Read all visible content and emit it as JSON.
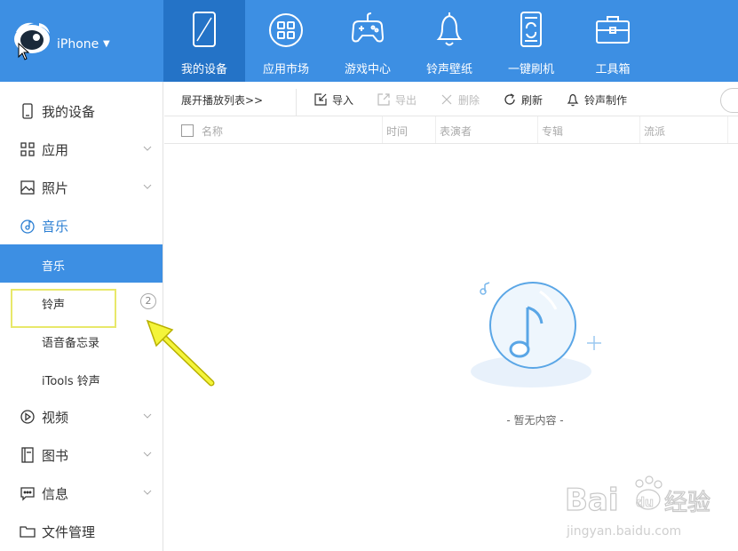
{
  "device": {
    "name": "iPhone"
  },
  "nav": [
    {
      "label": "我的设备",
      "icon": "tablet-icon",
      "active": true
    },
    {
      "label": "应用市场",
      "icon": "apps-grid-icon",
      "active": false
    },
    {
      "label": "游戏中心",
      "icon": "gamepad-icon",
      "active": false
    },
    {
      "label": "铃声壁纸",
      "icon": "bell-icon",
      "active": false
    },
    {
      "label": "一键刷机",
      "icon": "flash-phone-icon",
      "active": false
    },
    {
      "label": "工具箱",
      "icon": "toolbox-icon",
      "active": false
    }
  ],
  "sidebar": {
    "items": [
      {
        "label": "我的设备",
        "icon": "phone-icon"
      },
      {
        "label": "应用",
        "icon": "grid-icon"
      },
      {
        "label": "照片",
        "icon": "image-icon"
      },
      {
        "label": "音乐",
        "icon": "music-disc-icon"
      },
      {
        "label": "音乐",
        "icon": ""
      },
      {
        "label": "铃声",
        "icon": "",
        "badge": "2"
      },
      {
        "label": "语音备忘录",
        "icon": ""
      },
      {
        "label": "iTools 铃声",
        "icon": ""
      },
      {
        "label": "视频",
        "icon": "play-icon"
      },
      {
        "label": "图书",
        "icon": "book-icon"
      },
      {
        "label": "信息",
        "icon": "message-icon"
      },
      {
        "label": "文件管理",
        "icon": "folder-icon"
      }
    ]
  },
  "toolbar": {
    "expand_label": "展开播放列表>>",
    "import_label": "导入",
    "export_label": "导出",
    "delete_label": "删除",
    "refresh_label": "刷新",
    "ringtone_label": "铃声制作"
  },
  "table": {
    "columns": [
      "名称",
      "时间",
      "表演者",
      "专辑",
      "流派"
    ]
  },
  "empty": {
    "text": "- 暂无内容 -"
  },
  "watermark": {
    "brand": "Bai",
    "brand2": "du",
    "cn": "经验",
    "url": "jingyan.baidu.com"
  },
  "colors": {
    "accent": "#3d8fe3",
    "accent_dark": "#2473c7",
    "highlight": "#e8e86a"
  }
}
